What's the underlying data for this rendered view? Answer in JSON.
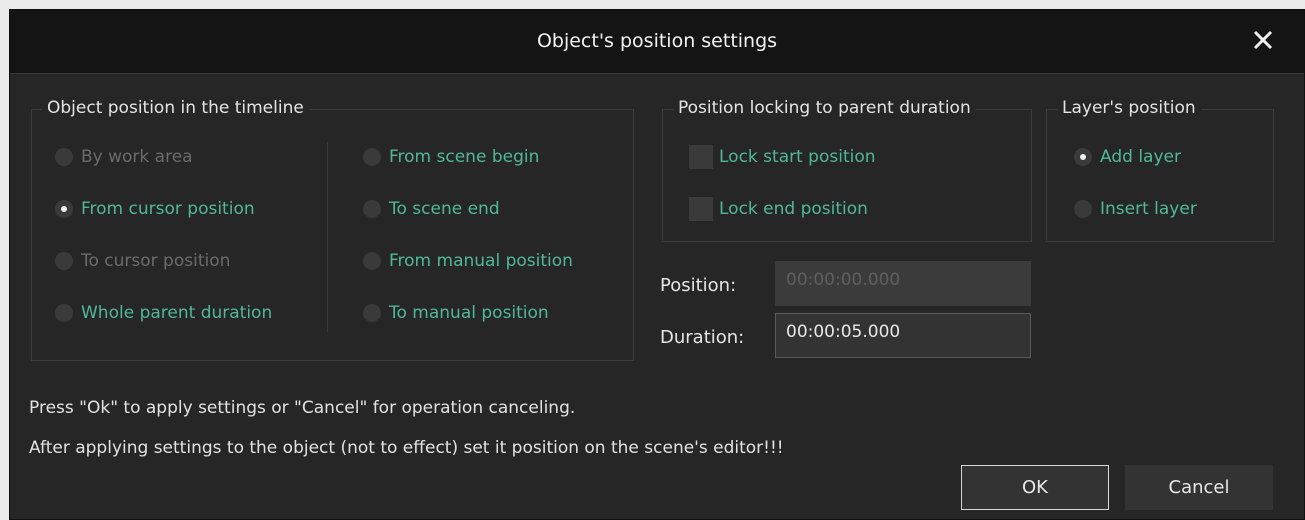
{
  "window": {
    "title": "Object's position settings",
    "close_icon": "close-icon"
  },
  "timeline_group": {
    "title": "Object position in the timeline",
    "left_options": [
      {
        "label": "By work area",
        "selected": false,
        "enabled": false
      },
      {
        "label": "From cursor position",
        "selected": true,
        "enabled": true
      },
      {
        "label": "To cursor position",
        "selected": false,
        "enabled": false
      },
      {
        "label": "Whole parent duration",
        "selected": false,
        "enabled": true
      }
    ],
    "right_options": [
      {
        "label": "From scene begin",
        "selected": false,
        "enabled": true
      },
      {
        "label": "To scene end",
        "selected": false,
        "enabled": true
      },
      {
        "label": "From manual position",
        "selected": false,
        "enabled": true
      },
      {
        "label": "To manual position",
        "selected": false,
        "enabled": true
      }
    ]
  },
  "locking_group": {
    "title": "Position locking to parent duration",
    "options": [
      {
        "label": "Lock start position",
        "checked": false
      },
      {
        "label": "Lock end position",
        "checked": false
      }
    ]
  },
  "layer_group": {
    "title": "Layer's position",
    "options": [
      {
        "label": "Add layer",
        "selected": true
      },
      {
        "label": "Insert layer",
        "selected": false
      }
    ]
  },
  "fields": {
    "position_label": "Position:",
    "position_value": "00:00:00.000",
    "duration_label": "Duration:",
    "duration_value": "00:00:05.000"
  },
  "messages": {
    "line1": "Press \"Ok\" to apply settings or \"Cancel\" for operation canceling.",
    "line2": "After applying settings to the object (not to effect) set it position on the scene's editor!!!"
  },
  "buttons": {
    "ok": "OK",
    "cancel": "Cancel"
  },
  "colors": {
    "background": "#262626",
    "titlebar": "#141414",
    "option_text": "#4fb89a",
    "disabled_text": "#6b6b6b"
  }
}
